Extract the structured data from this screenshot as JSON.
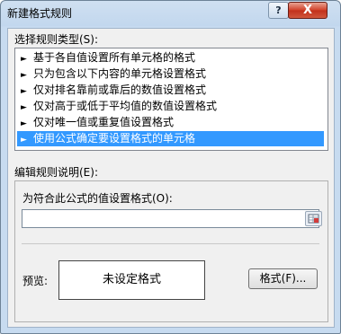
{
  "window": {
    "title": "新建格式规则",
    "help": "?",
    "close": "X"
  },
  "rule_type": {
    "label": "选择规则类型(S):",
    "items": [
      {
        "label": "基于各自值设置所有单元格的格式"
      },
      {
        "label": "只为包含以下内容的单元格设置格式"
      },
      {
        "label": "仅对排名靠前或靠后的数值设置格式"
      },
      {
        "label": "仅对高于或低于平均值的数值设置格式"
      },
      {
        "label": "仅对唯一值或重复值设置格式"
      },
      {
        "label": "使用公式确定要设置格式的单元格",
        "selected": true
      }
    ],
    "arrow": "►"
  },
  "rule_desc": {
    "label": "编辑规则说明(E):",
    "formula_label": "为符合此公式的值设置格式(O):",
    "formula_value": "",
    "preview_label": "预览:",
    "preview_text": "未设定格式",
    "format_button": "格式(F)..."
  },
  "colors": {
    "selection": "#3399ff",
    "close": "#c7402a"
  }
}
